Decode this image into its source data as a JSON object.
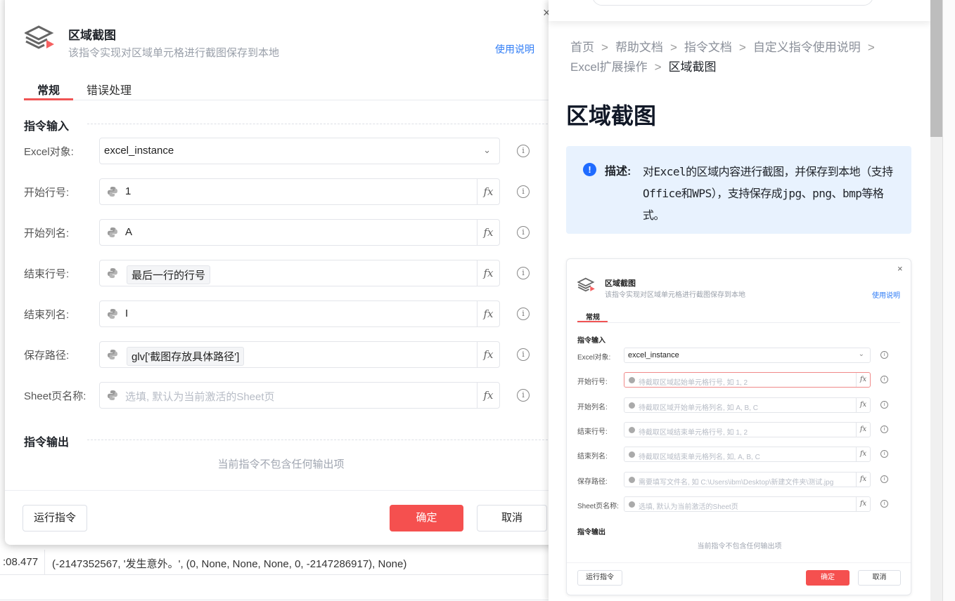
{
  "background": {
    "log_time": ":08.477",
    "log_text": "(-2147352567, '发生意外。', (0, None, None, None, 0, -2147286917), None)"
  },
  "dialog": {
    "title": "区域截图",
    "subtitle": "该指令实现对区域单元格进行截图保存到本地",
    "help_link": "使用说明",
    "close": "×",
    "tabs": [
      {
        "label": "常规"
      },
      {
        "label": "错误处理"
      }
    ],
    "input_section": "指令输入",
    "output_section": "指令输出",
    "no_output": "当前指令不包含任何输出项",
    "fields": [
      {
        "label": "Excel对象:",
        "value": "excel_instance"
      },
      {
        "label": "开始行号:",
        "value": "1"
      },
      {
        "label": "开始列名:",
        "value": "A"
      },
      {
        "label": "结束行号:",
        "value": "最后一行的行号"
      },
      {
        "label": "结束列名:",
        "value": "I"
      },
      {
        "label": "保存路径:",
        "value": "glv['截图存放具体路径']"
      },
      {
        "label": "Sheet页名称:",
        "placeholder": "选填, 默认为当前激活的Sheet页"
      }
    ],
    "fx": "fx",
    "info": "i",
    "run_button": "运行指令",
    "ok_button": "确定",
    "cancel_button": "取消",
    "colors": {
      "accent": "#f5504f",
      "link": "#2f7cf6"
    }
  },
  "doc": {
    "breadcrumb": [
      "首页",
      "帮助文档",
      "指令文档",
      "自定义指令使用说明",
      "Excel扩展操作",
      "区域截图"
    ],
    "sep": ">",
    "heading": "区域截图",
    "note_key": "描述:",
    "note_text": "对Excel的区域内容进行截图，并保存到本地（支持Office和WPS），支持保存成jpg、png、bmp等格式。",
    "note_icon": "!",
    "preview": {
      "title": "区域截图",
      "subtitle": "该指令实现对区域单元格进行截图保存到本地",
      "help": "使用说明",
      "tab": "常规",
      "input_section": "指令输入",
      "output_section": "指令输出",
      "no_output": "当前指令不包含任何输出项",
      "fields": [
        {
          "label": "Excel对象:",
          "value": "excel_instance"
        },
        {
          "label": "开始行号:",
          "placeholder": "待截取区域起始单元格行号, 如 1, 2"
        },
        {
          "label": "开始列名:",
          "placeholder": "待截取区域开始单元格列名, 如 A, B, C"
        },
        {
          "label": "结束行号:",
          "placeholder": "待截取区域结束单元格行号,  如 1, 2"
        },
        {
          "label": "结束列名:",
          "placeholder": "待截取区域结束单元格列名, 如, A, B, C"
        },
        {
          "label": "保存路径:",
          "placeholder": "需要填写文件名, 如 C:\\Users\\ibm\\Desktop\\新建文件夹\\测试.jpg"
        },
        {
          "label": "Sheet页名称:",
          "placeholder": "选填, 默认为当前激活的Sheet页"
        }
      ],
      "run": "运行指令",
      "ok": "确定",
      "cancel": "取消"
    }
  }
}
